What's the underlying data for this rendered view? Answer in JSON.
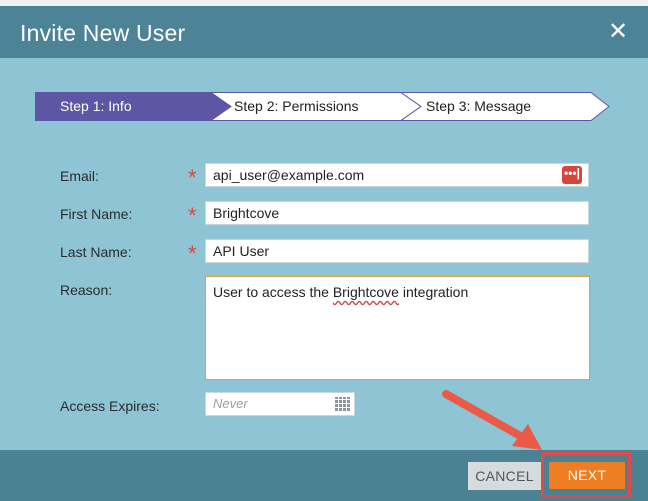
{
  "dialog": {
    "title": "Invite New User",
    "close_symbol": "✕"
  },
  "steps": [
    {
      "label": "Step 1: Info",
      "active": true
    },
    {
      "label": "Step 2: Permissions",
      "active": false
    },
    {
      "label": "Step 3: Message",
      "active": false
    }
  ],
  "form": {
    "email": {
      "label": "Email:",
      "value": "api_user@example.com",
      "required": true
    },
    "first_name": {
      "label": "First Name:",
      "value": "Brightcove",
      "required": true
    },
    "last_name": {
      "label": "Last Name:",
      "value": "API User",
      "required": true
    },
    "reason": {
      "label": "Reason:",
      "value_before": "User to access the ",
      "value_misspelled": "Brightcove",
      "value_after": " integration"
    },
    "access_expires": {
      "label": "Access Expires:",
      "placeholder": "Never"
    }
  },
  "required_marker": "*",
  "footer": {
    "cancel_label": "CANCEL",
    "next_label": "NEXT"
  },
  "colors": {
    "header": "#4c8396",
    "content": "#8fc4d4",
    "active_step": "#5c56a5",
    "next_button": "#ef7d21",
    "highlight": "#e04a48"
  }
}
